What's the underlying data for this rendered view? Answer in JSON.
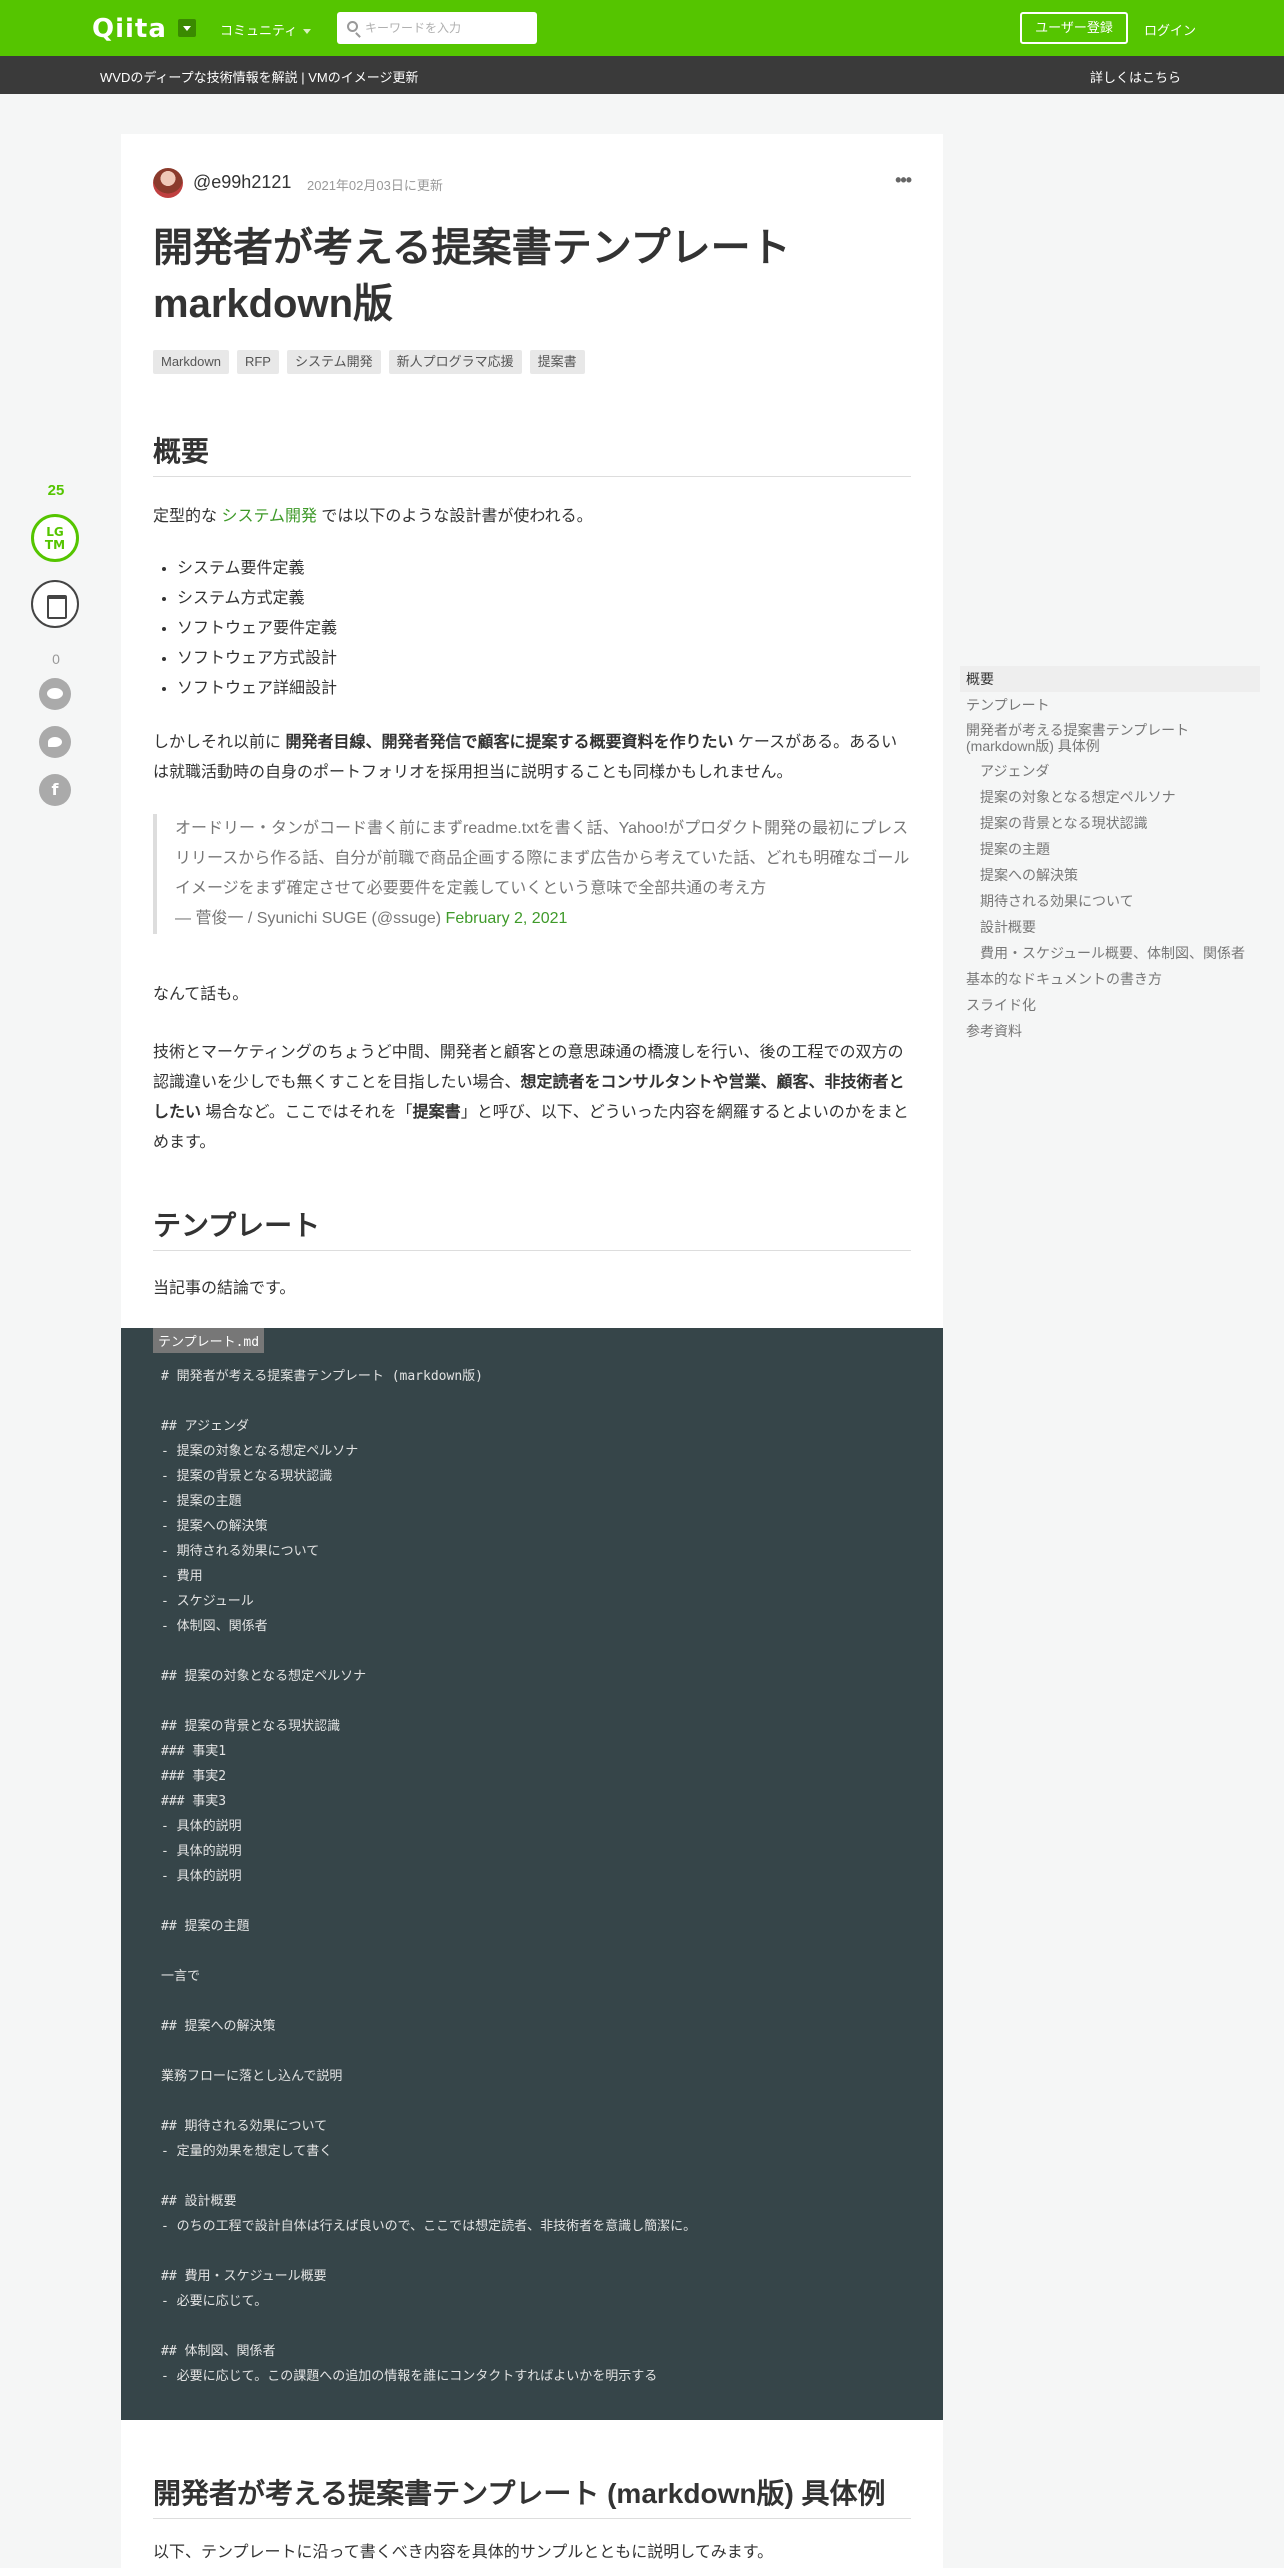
{
  "header": {
    "logo": "Qiita",
    "community": "コミュニティ",
    "search_placeholder": "キーワードを入力",
    "signup": "ユーザー登録",
    "login": "ログイン"
  },
  "banner": {
    "text": "WVDのディープな技術情報を解説 | VMのイメージ更新",
    "link": "詳しくはこちら"
  },
  "actions": {
    "lgtm_count": "25",
    "lgtm_label_1": "LG",
    "lgtm_label_2": "TM",
    "comment_count": "0",
    "facebook_glyph": "f"
  },
  "article": {
    "author": "@e99h2121",
    "updated": "2021年02月03日に更新",
    "more": "•••",
    "title_line1": "開発者が考える提案書テンプレート",
    "title_line2": "markdown版",
    "tags": [
      "Markdown",
      "RFP",
      "システム開発",
      "新人プログラマ応援",
      "提案書"
    ],
    "h_overview": "概要",
    "intro_pre": "定型的な ",
    "intro_link": "システム開発",
    "intro_post": " では以下のような設計書が使われる。",
    "list": [
      "システム要件定義",
      "システム方式定義",
      "ソフトウェア要件定義",
      "ソフトウェア方式設計",
      "ソフトウェア詳細設計"
    ],
    "p2_pre": "しかしそれ以前に ",
    "p2_bold": "開発者目線、開発者発信で顧客に提案する概要資料を作りたい",
    "p2_post": " ケースがある。あるいは就職活動時の自身のポートフォリオを採用担当に説明することも同様かもしれません。",
    "quote_text": "オードリー・タンがコード書く前にまずreadme.txtを書く話、Yahoo!がプロダクト開発の最初にプレスリリースから作る話、自分が前職で商品企画する際にまず広告から考えていた話、どれも明確なゴールイメージをまず確定させて必要要件を定義していくという意味で全部共通の考え方",
    "quote_author": "— 菅俊一 / Syunichi SUGE (@ssuge) ",
    "quote_date": "February 2, 2021",
    "p3": "なんて話も。",
    "p4_pre": "技術とマーケティングのちょうど中間、開発者と顧客との意思疎通の橋渡しを行い、後の工程での双方の認識違いを少しでも無くすことを目指したい場合、",
    "p4_bold": "想定読者をコンサルタントや営業、顧客、非技術者としたい",
    "p4_mid": " 場合など。ここではそれを「",
    "p4_bold2": "提案書",
    "p4_post": "」と呼び、以下、どういった内容を網羅するとよいのかをまとめます。",
    "h_template": "テンプレート",
    "template_intro": "当記事の結論です。",
    "code_filename": "テンプレート.md",
    "code": "# 開発者が考える提案書テンプレート (markdown版)\n\n## アジェンダ\n- 提案の対象となる想定ペルソナ\n- 提案の背景となる現状認識\n- 提案の主題\n- 提案への解決策\n- 期待される効果について\n- 費用\n- スケジュール\n- 体制図、関係者\n\n## 提案の対象となる想定ペルソナ\n\n## 提案の背景となる現状認識\n### 事実1\n### 事実2\n### 事実3\n- 具体的説明\n- 具体的説明\n- 具体的説明\n\n## 提案の主題\n\n一言で\n\n## 提案への解決策\n\n業務フローに落とし込んで説明\n\n## 期待される効果について\n- 定量的効果を想定して書く\n\n## 設計概要\n- のちの工程で設計自体は行えば良いので、ここでは想定読者、非技術者を意識し簡潔に。\n\n## 費用・スケジュール概要\n- 必要に応じて。\n\n## 体制図、関係者\n- 必要に応じて。この課題への追加の情報を誰にコンタクトすればよいかを明示する",
    "h_example": "開発者が考える提案書テンプレート (markdown版) 具体例",
    "example_intro": "以下、テンプレートに沿って書くべき内容を具体的サンプルとともに説明してみます。"
  },
  "toc": [
    {
      "label": "概要",
      "level": 1,
      "active": true
    },
    {
      "label": "テンプレート",
      "level": 1
    },
    {
      "label": "開発者が考える提案書テンプレート (markdown版) 具体例",
      "level": 1
    },
    {
      "label": "アジェンダ",
      "level": 2
    },
    {
      "label": "提案の対象となる想定ペルソナ",
      "level": 2
    },
    {
      "label": "提案の背景となる現状認識",
      "level": 2
    },
    {
      "label": "提案の主題",
      "level": 2
    },
    {
      "label": "提案への解決策",
      "level": 2
    },
    {
      "label": "期待される効果について",
      "level": 2
    },
    {
      "label": "設計概要",
      "level": 2
    },
    {
      "label": "費用・スケジュール概要、体制図、関係者",
      "level": 2
    },
    {
      "label": "基本的なドキュメントの書き方",
      "level": 1
    },
    {
      "label": "スライド化",
      "level": 1
    },
    {
      "label": "参考資料",
      "level": 1
    }
  ]
}
